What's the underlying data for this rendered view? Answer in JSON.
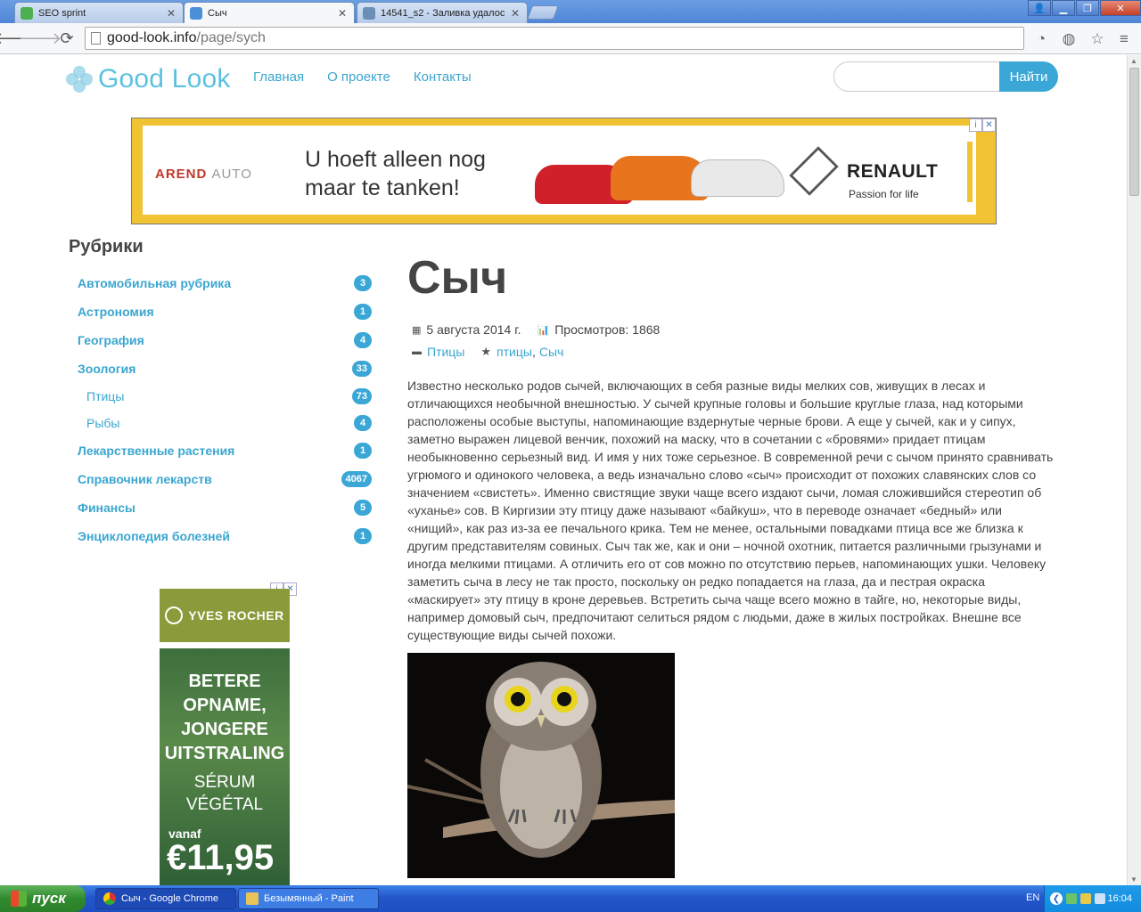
{
  "browser": {
    "tabs": [
      {
        "title": "SEO sprint",
        "favicon_color": "#4caf50"
      },
      {
        "title": "Сыч",
        "favicon_color": "#4a90d9"
      },
      {
        "title": "14541_s2 - Заливка удалос",
        "favicon_color": "#6a8fb5"
      }
    ],
    "url_host": "good-look.info",
    "url_path": "/page/sych"
  },
  "site": {
    "logo_text": "Good Look",
    "nav": [
      "Главная",
      "О проекте",
      "Контакты"
    ],
    "search_placeholder": "",
    "search_button": "Найти"
  },
  "ad_top": {
    "brand_left": "AREND",
    "brand_left_2": "AUTO",
    "slogan": "U hoeft alleen nog maar te tanken!",
    "brand_right": "RENAULT",
    "tagline": "Passion for life"
  },
  "sidebar": {
    "title": "Рубрики",
    "items": [
      {
        "label": "Автомобильная рубрика",
        "count": "3",
        "sub": false
      },
      {
        "label": "Астрономия",
        "count": "1",
        "sub": false
      },
      {
        "label": "География",
        "count": "4",
        "sub": false
      },
      {
        "label": "Зоология",
        "count": "33",
        "sub": false
      },
      {
        "label": "Птицы",
        "count": "73",
        "sub": true
      },
      {
        "label": "Рыбы",
        "count": "4",
        "sub": true
      },
      {
        "label": "Лекарственные растения",
        "count": "1",
        "sub": false
      },
      {
        "label": "Справочник лекарств",
        "count": "4067",
        "sub": false
      },
      {
        "label": "Финансы",
        "count": "5",
        "sub": false
      },
      {
        "label": "Энциклопедия болезней",
        "count": "1",
        "sub": false
      }
    ]
  },
  "ad_side": {
    "brand": "YVES ROCHER",
    "headline": "BETERE OPNAME, JONGERE UITSTRALING",
    "product": "SÉRUM VÉGÉTAL",
    "from": "vanaf",
    "price": "€11,95"
  },
  "article": {
    "title": "Сыч",
    "date": "5 августа 2014 г.",
    "views": "Просмотров: 1868",
    "category": "Птицы",
    "tag1": "птицы",
    "tag_sep": ",",
    "tag2": "Сыч",
    "text": "Известно несколько родов сычей, включающих в себя разные виды мелких сов, живущих в лесах и отличающихся необычной внешностью. У сычей крупные головы и большие круглые глаза, над которыми расположены особые выступы, напоминающие вздернутые черные брови. А еще у сычей, как и у сипух, заметно выражен лицевой венчик, похожий на маску, что в сочетании с «бровями» придает птицам необыкновенно серьезный вид. И имя у них тоже серьезное. В современной речи с сычом принято сравнивать угрюмого и одинокого человека, а ведь изначально слово «сыч» происходит от похожих славянских слов со значением «свистеть». Именно свистящие звуки чаще всего издают сычи, ломая сложившийся стереотип об «уханье» сов. В Киргизии эту птицу даже называют «байкуш», что в переводе означает «бедный» или «нищий», как раз из-за ее печального крика. Тем не менее, остальными повадками птица все же близка к другим представителям совиных. Сыч так же, как и они – ночной охотник, питается различными грызунами и иногда мелкими птицами. А отличить его от сов можно по отсутствию перьев, напоминающих ушки. Человеку заметить сыча в лесу не так просто, поскольку он редко попадается на глаза, да и пестрая окраска «маскирует» эту птицу в кроне деревьев. Встретить сыча чаще всего можно в тайге, но, некоторые виды, например домовый сыч, предпочитают селиться рядом с людьми, даже в жилых постройках. Внешне все существующие виды сычей похожи."
  },
  "taskbar": {
    "start": "пуск",
    "tasks": [
      "Сыч - Google Chrome",
      "Безымянный - Paint"
    ],
    "lang": "EN",
    "clock": "16:04"
  },
  "colors": {
    "accent": "#3ba7d6",
    "link": "#3aa6d0"
  }
}
